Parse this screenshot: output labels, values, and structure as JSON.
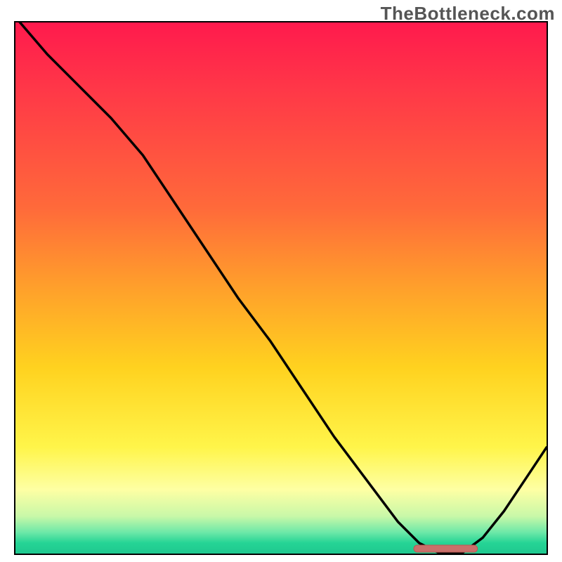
{
  "watermark": "TheBottleneck.com",
  "chart_data": {
    "type": "line",
    "title": "",
    "xlabel": "",
    "ylabel": "",
    "xlim": [
      0,
      100
    ],
    "ylim": [
      0,
      100
    ],
    "grid": false,
    "legend": false,
    "series": [
      {
        "name": "bottleneck-curve",
        "x": [
          0,
          6,
          12,
          18,
          24,
          30,
          36,
          42,
          48,
          54,
          60,
          66,
          72,
          76,
          80,
          84,
          88,
          92,
          96,
          100
        ],
        "y": [
          101,
          94,
          88,
          82,
          75,
          66,
          57,
          48,
          40,
          31,
          22,
          14,
          6,
          2,
          0,
          0,
          3,
          8,
          14,
          20
        ]
      }
    ],
    "marker": {
      "name": "optimal-range-bar",
      "x_start": 75,
      "x_end": 87,
      "y": 0,
      "color": "#c96f6a"
    },
    "background_gradient": {
      "top_color": "#ff1a4d",
      "mid_color": "#ffd21f",
      "bottom_color": "#1fc88f"
    }
  }
}
